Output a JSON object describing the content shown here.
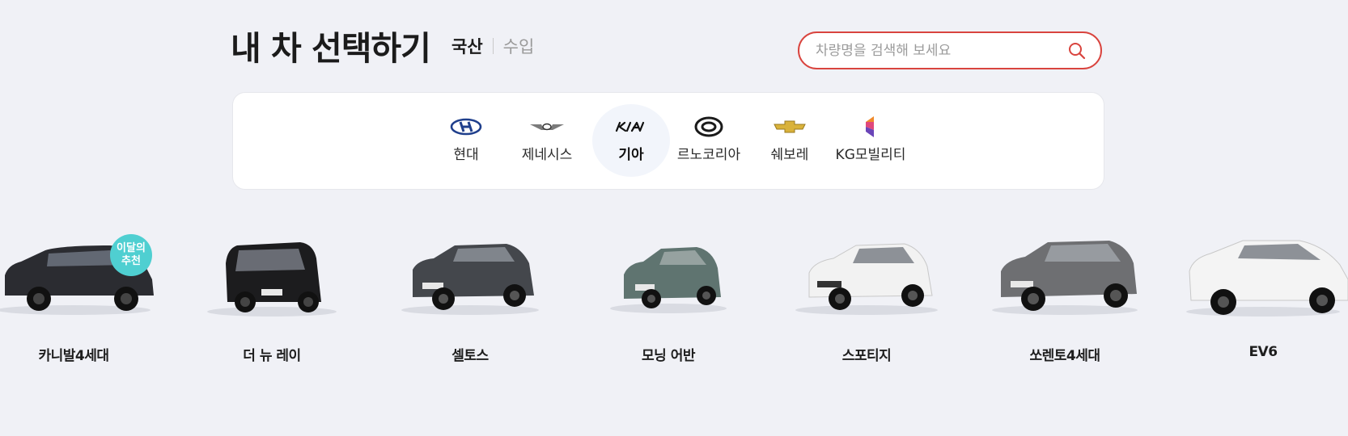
{
  "header": {
    "title": "내 차 선택하기",
    "origin_tabs": [
      {
        "label": "국산",
        "active": true
      },
      {
        "label": "수입",
        "active": false
      }
    ]
  },
  "search": {
    "placeholder": "차량명을 검색해 보세요",
    "value": "",
    "icon": "search-icon"
  },
  "brands": [
    {
      "label": "현대",
      "icon": "hyundai-logo-icon",
      "active": false
    },
    {
      "label": "제네시스",
      "icon": "genesis-logo-icon",
      "active": false
    },
    {
      "label": "기아",
      "icon": "kia-logo-icon",
      "active": true
    },
    {
      "label": "르노코리아",
      "icon": "renault-korea-logo-icon",
      "active": false
    },
    {
      "label": "쉐보레",
      "icon": "chevrolet-logo-icon",
      "active": false
    },
    {
      "label": "KG모빌리티",
      "icon": "kg-mobility-logo-icon",
      "active": false
    }
  ],
  "badge": {
    "line1": "이달의",
    "line2": "추천"
  },
  "cars": [
    {
      "name": "카니발4세대",
      "color": "#2b2c31"
    },
    {
      "name": "더 뉴 레이",
      "color": "#1c1c1e"
    },
    {
      "name": "셀토스",
      "color": "#44474c"
    },
    {
      "name": "모닝 어반",
      "color": "#5f7470"
    },
    {
      "name": "스포티지",
      "color": "#f2f2f2"
    },
    {
      "name": "쏘렌토4세대",
      "color": "#6e6f72"
    },
    {
      "name": "EV6",
      "color": "#f4f4f4"
    }
  ],
  "colors": {
    "accent": "#d9443e",
    "badge": "#4fcfd1",
    "background": "#f0f1f6"
  }
}
